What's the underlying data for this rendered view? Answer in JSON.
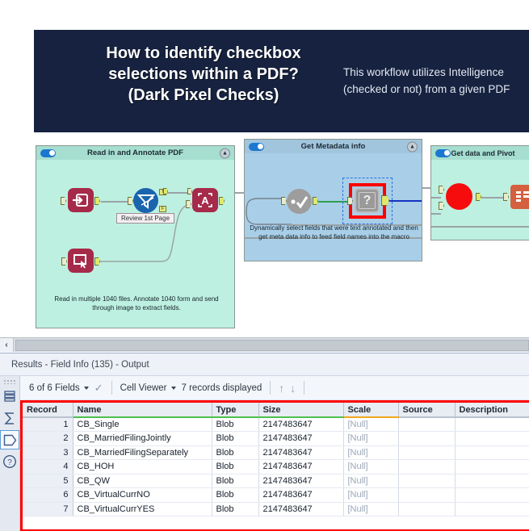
{
  "banner": {
    "title": "How to identify checkbox\nselections within a PDF?\n(Dark Pixel Checks)",
    "body": "This workflow utilizes Intelligence\n(checked or not) from a given PDF"
  },
  "canvas": {
    "scroll_left_icon": "chevron-left-icon",
    "containers": [
      {
        "name": "Read in and Annotate PDF",
        "collapse_icon": "collapse-up-icon",
        "annotation": "Read in multiple 1040 files. Annotate 1040\nform and send through image to extract fields.",
        "node_label": "Review 1st Page",
        "port_true": "T",
        "port_false": "F"
      },
      {
        "name": "Get Metadata info",
        "collapse_icon": "collapse-up-icon",
        "annotation": "Dynamically select fields that were text\nannotated and then get meta data info to\nfeed field names into the macro",
        "macro_glyph": "?"
      },
      {
        "name": "Get data and Pivot",
        "collapse_icon": "collapse-up-icon"
      }
    ]
  },
  "results": {
    "title": "Results - Field Info (135) - Output",
    "rail": [
      {
        "icon": "list-rows-icon",
        "selected": false
      },
      {
        "icon": "sigma-icon",
        "selected": false
      },
      {
        "icon": "tag-pentagon-icon",
        "selected": true
      },
      {
        "icon": "help-question-icon",
        "selected": false
      }
    ],
    "toolbar": {
      "fields": "6 of 6 Fields",
      "fields_caret": "chevron-down-icon",
      "check_icon": "checkmark-icon",
      "viewer": "Cell Viewer",
      "viewer_caret": "chevron-down-icon",
      "records": "7 records displayed",
      "up_icon": "arrow-up-icon",
      "down_icon": "arrow-down-icon"
    },
    "table": {
      "columns": [
        "Record",
        "Name",
        "Type",
        "Size",
        "Scale",
        "Source",
        "Description"
      ],
      "rows": [
        {
          "record": "1",
          "name": "CB_Single",
          "type": "Blob",
          "size": "2147483647",
          "scale": "[Null]",
          "source": "",
          "description": ""
        },
        {
          "record": "2",
          "name": "CB_MarriedFilingJointly",
          "type": "Blob",
          "size": "2147483647",
          "scale": "[Null]",
          "source": "",
          "description": ""
        },
        {
          "record": "3",
          "name": "CB_MarriedFilingSeparately",
          "type": "Blob",
          "size": "2147483647",
          "scale": "[Null]",
          "source": "",
          "description": ""
        },
        {
          "record": "4",
          "name": "CB_HOH",
          "type": "Blob",
          "size": "2147483647",
          "scale": "[Null]",
          "source": "",
          "description": ""
        },
        {
          "record": "5",
          "name": "CB_QW",
          "type": "Blob",
          "size": "2147483647",
          "scale": "[Null]",
          "source": "",
          "description": ""
        },
        {
          "record": "6",
          "name": "CB_VirtualCurrNO",
          "type": "Blob",
          "size": "2147483647",
          "scale": "[Null]",
          "source": "",
          "description": ""
        },
        {
          "record": "7",
          "name": "CB_VirtualCurrYES",
          "type": "Blob",
          "size": "2147483647",
          "scale": "[Null]",
          "source": "",
          "description": ""
        }
      ]
    }
  },
  "colors": {
    "banner_bg": "#16223f",
    "highlight_red": "#ff0000",
    "container_green": "#bdf0e0",
    "container_blue": "#a9cfe8",
    "tool_red": "#a62a4a",
    "toggle_blue": "#1b78d0",
    "header_underline_green": "#4ec04e",
    "header_underline_orange": "#f0a81e"
  }
}
